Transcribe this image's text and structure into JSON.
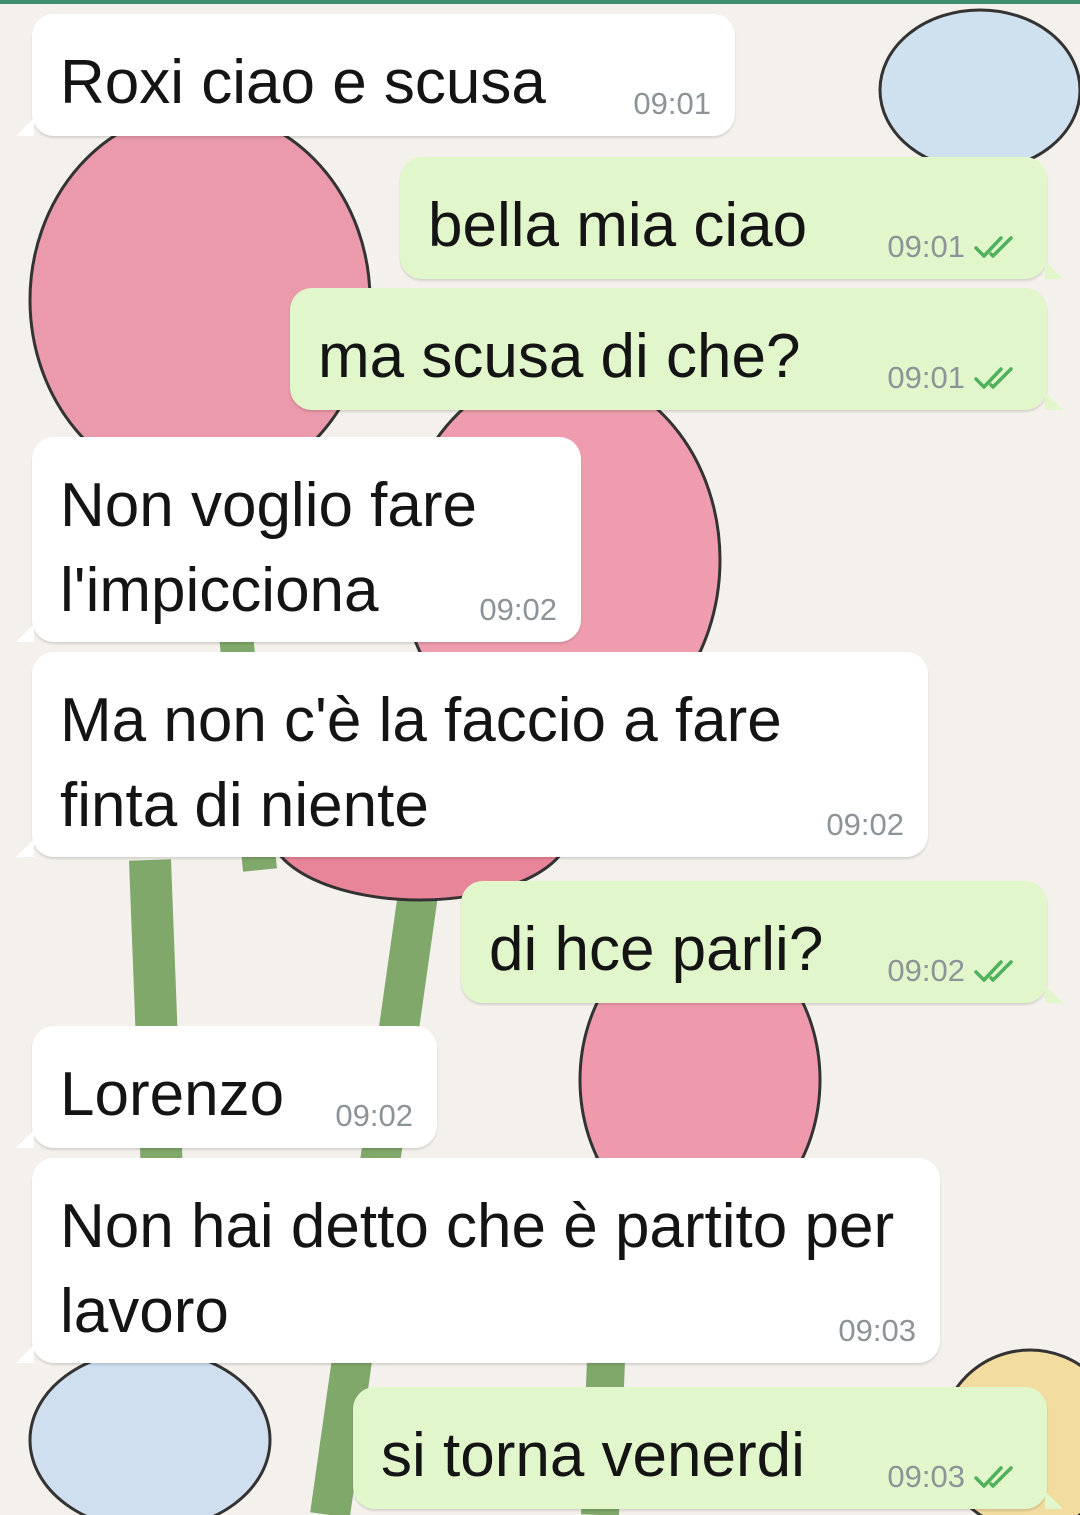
{
  "colors": {
    "incoming_bubble": "#ffffff",
    "outgoing_bubble": "#e1f7cb",
    "read_ticks": "#4fb15c",
    "timestamp": "#8c9498"
  },
  "messages": [
    {
      "dir": "in",
      "text": "Roxi ciao e scusa",
      "time": "09:01"
    },
    {
      "dir": "out",
      "text": "bella mia ciao",
      "time": "09:01",
      "status_icon": "double-check-icon"
    },
    {
      "dir": "out",
      "text": "ma scusa di che?",
      "time": "09:01",
      "status_icon": "double-check-icon"
    },
    {
      "dir": "in",
      "text": "Non voglio fare l'impicciona",
      "time": "09:02"
    },
    {
      "dir": "in",
      "text": "Ma non c'è la faccio a fare finta di niente",
      "time": "09:02"
    },
    {
      "dir": "out",
      "text": "di hce parli?",
      "time": "09:02",
      "status_icon": "double-check-icon"
    },
    {
      "dir": "in",
      "text": "Lorenzo",
      "time": "09:02"
    },
    {
      "dir": "in",
      "text": "Non hai detto che è partito per lavoro",
      "time": "09:03"
    },
    {
      "dir": "out",
      "text": "si torna venerdi",
      "time": "09:03",
      "status_icon": "double-check-icon"
    }
  ]
}
